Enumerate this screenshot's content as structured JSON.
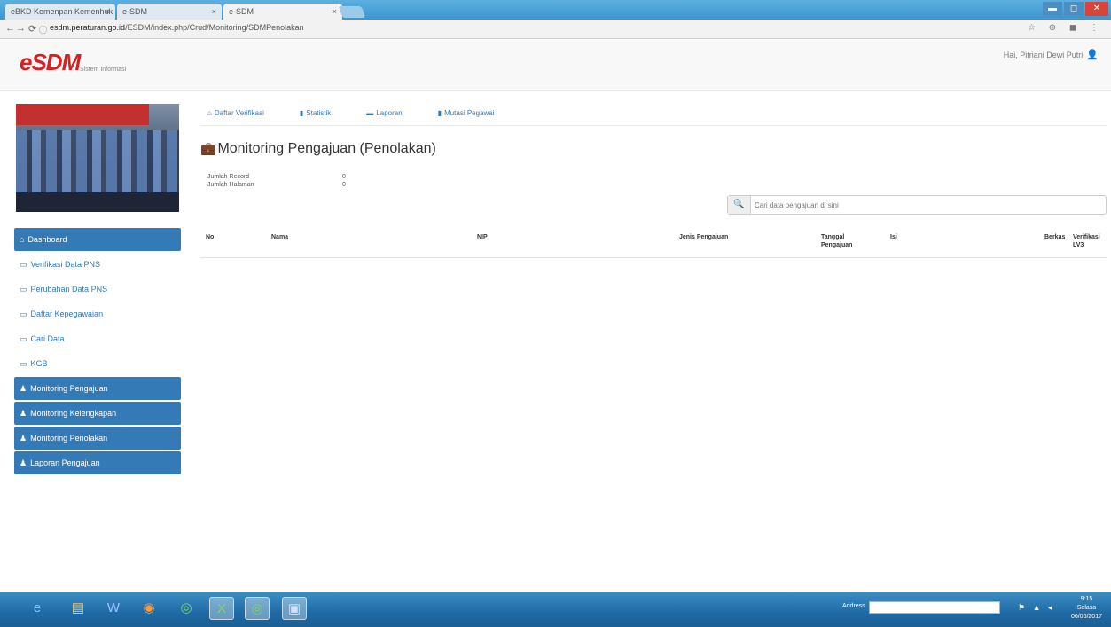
{
  "browser": {
    "tabs": [
      {
        "label": "eBKD Kemenpan Kemenhuk"
      },
      {
        "label": "e-SDM"
      },
      {
        "label": "e-SDM"
      }
    ],
    "window_controls": {
      "minimize": "▬",
      "maximize": "◻",
      "close": "✕"
    },
    "nav": {
      "back": "←",
      "forward": "→",
      "reload": "⟳",
      "info": "ⓘ"
    },
    "url_host": "esdm.peraturan.go.id",
    "url_path": "/ESDM/index.php/Crud/Monitoring/SDMPenolakan",
    "extensions": "☆ ⊕ ◼ ⋮"
  },
  "header": {
    "logo_text": "eSDM",
    "logo_sub": "Sistem Informasi",
    "user_label": "Hai, Pitriani Dewi Putri",
    "user_icon": "person-icon"
  },
  "sidebar": {
    "items": [
      {
        "label": "Dashboard",
        "icon": "home-icon",
        "style": "dark"
      },
      {
        "label": "Verifikasi Data PNS",
        "icon": "monitor-icon",
        "style": "link"
      },
      {
        "label": "Perubahan Data PNS",
        "icon": "monitor-icon",
        "style": "link"
      },
      {
        "label": "Daftar Kepegawaian",
        "icon": "monitor-icon",
        "style": "link"
      },
      {
        "label": "Cari Data",
        "icon": "monitor-icon",
        "style": "link"
      },
      {
        "label": "KGB",
        "icon": "monitor-icon",
        "style": "link"
      },
      {
        "label": "Monitoring Pengajuan",
        "icon": "person-icon",
        "style": "dark"
      },
      {
        "label": "Monitoring Kelengkapan",
        "icon": "person-icon",
        "style": "dark"
      },
      {
        "label": "Monitoring Penolakan",
        "icon": "person-icon",
        "style": "dark"
      },
      {
        "label": "Laporan Pengajuan",
        "icon": "person-icon",
        "style": "dark"
      }
    ]
  },
  "topnav": [
    {
      "label": "Daftar Verifikasi",
      "icon": "home-icon"
    },
    {
      "label": "Statistik",
      "icon": "chart-icon"
    },
    {
      "label": "Laporan",
      "icon": "briefcase-icon"
    },
    {
      "label": "Mutasi Pegawai",
      "icon": "chart-icon"
    }
  ],
  "main": {
    "title": "Monitoring Pengajuan (Penolakan)",
    "info": [
      {
        "label": "Jumlah Record",
        "value": "0"
      },
      {
        "label": "Jumlah Halaman",
        "value": "0"
      }
    ],
    "search_placeholder": "Cari data pengajuan di sini",
    "columns": [
      "No",
      "Nama",
      "NIP",
      "Jenis Pengajuan",
      "Tanggal Pengajuan",
      "Isi",
      "Berkas",
      "Verifikasi LV3"
    ]
  },
  "taskbar": {
    "icons": [
      "ie-icon",
      "explorer-icon",
      "word-icon",
      "firefox-icon",
      "chrome-icon",
      "excel-icon",
      "chrome-icon",
      "remote-icon"
    ],
    "address_label": "Address",
    "tray": "⚑ ▲ ◂",
    "time": "9:15",
    "day": "Selasa",
    "date": "06/06/2017"
  }
}
